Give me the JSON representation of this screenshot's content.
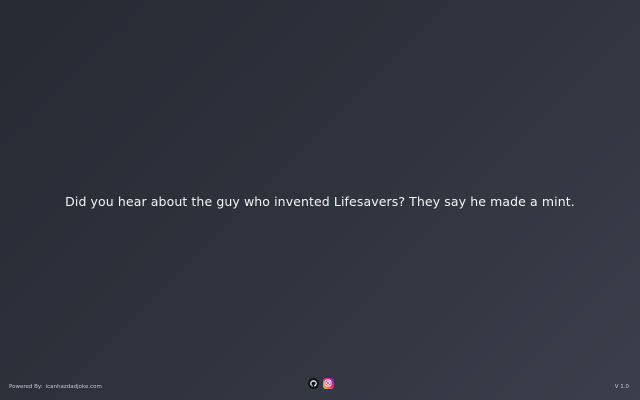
{
  "joke": {
    "text": "Did you hear about the guy who invented Lifesavers? They say he made a mint."
  },
  "footer": {
    "powered_prefix": "Powered By:",
    "powered_link": "icanhazdadjoke.com",
    "version": "V 1.0",
    "icons": {
      "github": "github-icon",
      "instagram": "instagram-icon"
    }
  },
  "colors": {
    "background_start": "#252a33",
    "background_end": "#3a3f4b",
    "text": "#f3f4f6"
  }
}
